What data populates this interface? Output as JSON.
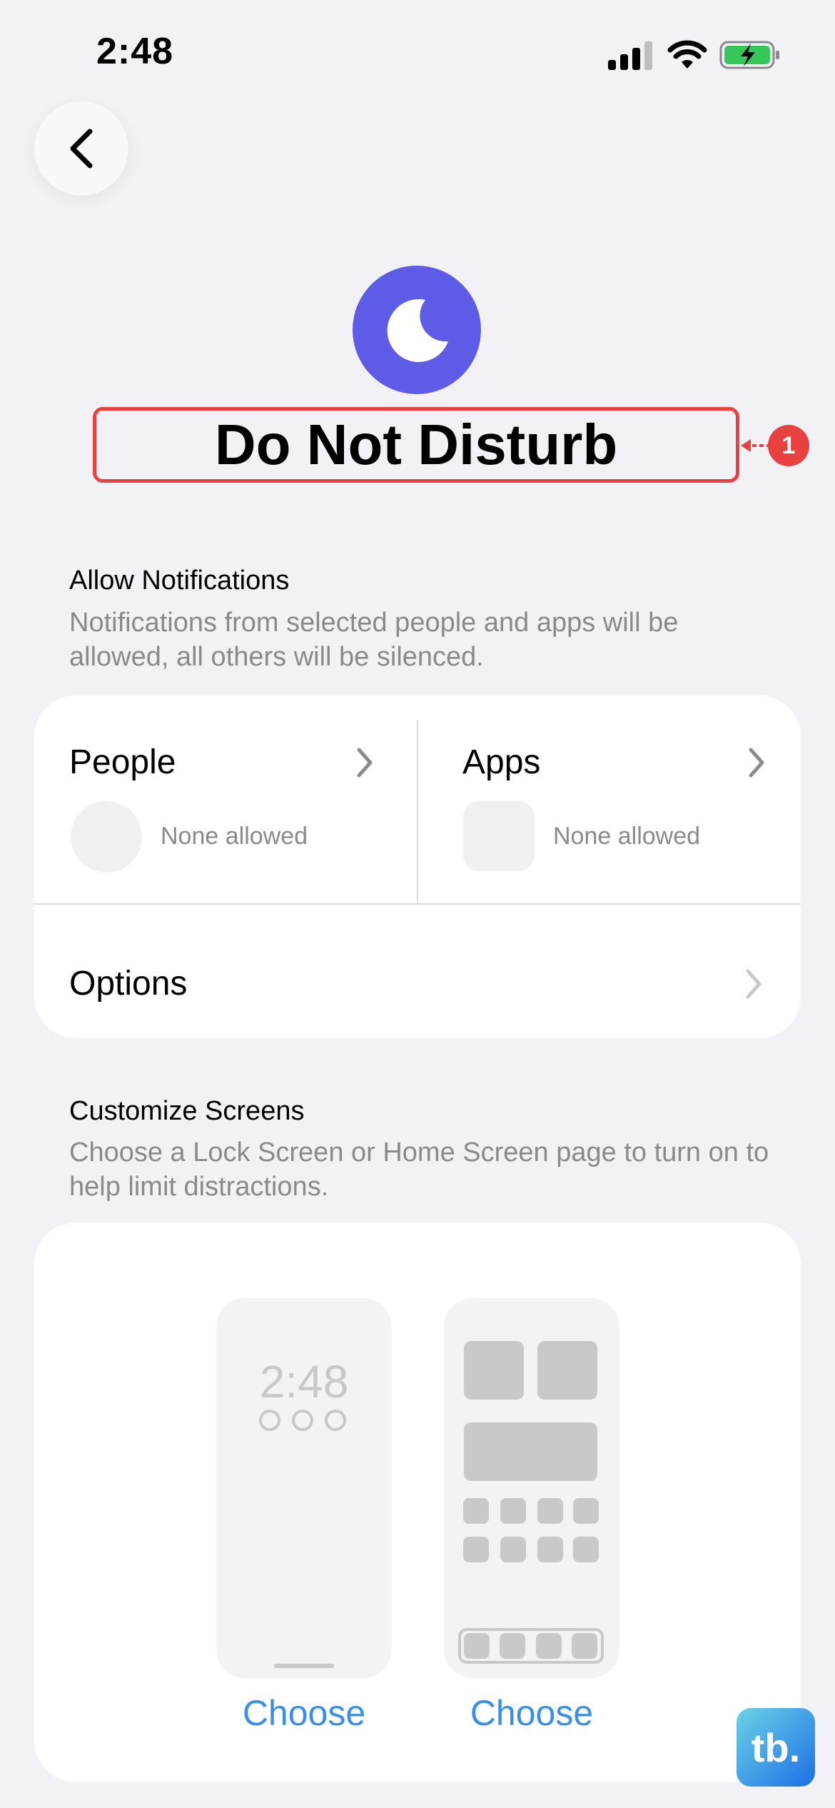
{
  "status_bar": {
    "time": "2:48"
  },
  "header": {
    "title": "Do Not Disturb",
    "annotation_number": "1",
    "focus_color": "#5e5ce6"
  },
  "allow_notifications": {
    "title": "Allow Notifications",
    "description": "Notifications from selected people and apps will be allowed, all others will be silenced.",
    "people": {
      "label": "People",
      "status": "None allowed"
    },
    "apps": {
      "label": "Apps",
      "status": "None allowed"
    },
    "options": {
      "label": "Options"
    }
  },
  "customize_screens": {
    "title": "Customize Screens",
    "description": "Choose a Lock Screen or Home Screen page to turn on to help limit distractions.",
    "lock_screen_time": "2:48",
    "choose_lock": "Choose",
    "choose_home": "Choose"
  },
  "watermark": {
    "text": "tb."
  },
  "colors": {
    "accent": "#3a8ee6",
    "annotation": "#e8413f",
    "background": "#f2f1f6"
  }
}
